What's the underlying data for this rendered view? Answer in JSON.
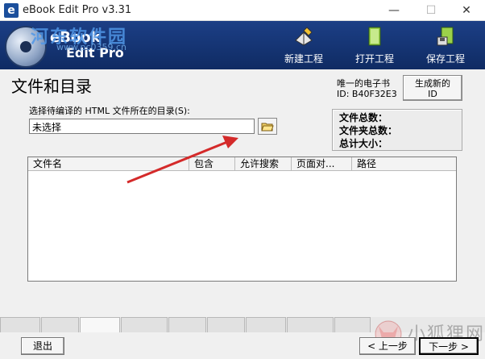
{
  "window": {
    "title": "eBook Edit Pro v3.31",
    "min": "—",
    "max": "☐",
    "close": "✕",
    "app_icon_letter": "e"
  },
  "banner": {
    "logo_line1": "eBook",
    "logo_line2": "Edit Pro",
    "watermark_name": "河东软件园",
    "watermark_url": "www.pc0359.cn"
  },
  "toolbar": {
    "new_project": "新建工程",
    "open_project": "打开工程",
    "save_project": "保存工程"
  },
  "page": {
    "heading": "文件和目录"
  },
  "unique_id": {
    "label": "唯一的电子书",
    "value": "ID: B40F32E3"
  },
  "gen_id_button": {
    "line1": "生成新的",
    "line2": "ID"
  },
  "stats": {
    "total_files": "文件总数：",
    "total_folders": "文件夹总数：",
    "total_size": "总计大小："
  },
  "directory": {
    "label": "选择待编译的 HTML 文件所在的目录(S):",
    "value": "未选择"
  },
  "file_list": {
    "columns": [
      "文件名",
      "包含",
      "允许搜索",
      "页面对...",
      "路径"
    ]
  },
  "buttons": {
    "exit": "退出",
    "prev": "< 上一步",
    "next": "下一步 >"
  },
  "watermark_bottom": "小狐狸网",
  "colors": {
    "banner": "#1c3f86",
    "arrow": "#d42a2a"
  }
}
